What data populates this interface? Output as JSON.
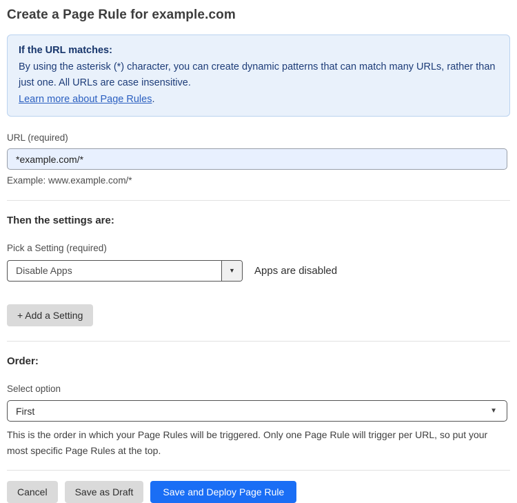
{
  "page": {
    "title": "Create a Page Rule for example.com"
  },
  "info_box": {
    "heading": "If the URL matches:",
    "body": "By using the asterisk (*) character, you can create dynamic patterns that can match many URLs, rather than just one. All URLs are case insensitive.",
    "link_label": "Learn more about Page Rules",
    "link_suffix": "."
  },
  "url_field": {
    "label": "URL (required)",
    "value": "*example.com/*",
    "helper": "Example: www.example.com/*"
  },
  "settings_section": {
    "heading": "Then the settings are:",
    "setting_label": "Pick a Setting (required)",
    "setting_value": "Disable Apps",
    "setting_status": "Apps are disabled",
    "add_setting_label": "+ Add a Setting",
    "caret_glyph": "▼"
  },
  "order_section": {
    "heading": "Order:",
    "select_label": "Select option",
    "select_value": "First",
    "caret_glyph": "▼",
    "helper": "This is the order in which your Page Rules will be triggered. Only one Page Rule will trigger per URL, so put your most specific Page Rules at the top."
  },
  "footer": {
    "cancel_label": "Cancel",
    "save_draft_label": "Save as Draft",
    "save_deploy_label": "Save and Deploy Page Rule"
  },
  "colors": {
    "accent_blue": "#1a6ef5",
    "info_box_bg": "#e9f1fb",
    "info_box_border": "#bad2ef",
    "info_text": "#1d3c78",
    "link_blue": "#2a5fc0",
    "url_input_bg": "#e8f0fe",
    "gray_button_bg": "#dadada"
  }
}
